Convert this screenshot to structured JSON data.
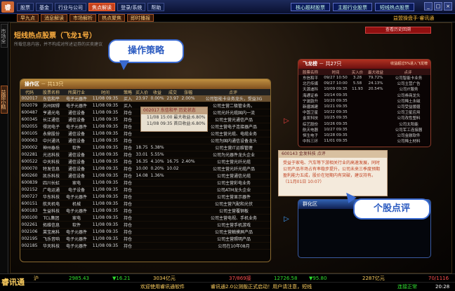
{
  "topbar": {
    "logo": "睿",
    "menu": [
      "股票",
      "基金",
      "行业与公司",
      "焦点解读",
      "登录/系统",
      "帮助"
    ],
    "active_menu": "焦点解读",
    "right_buttons": [
      "核心题材股票",
      "主题行业股票",
      "短线热点股票"
    ],
    "window_controls": [
      "_",
      "□",
      "×"
    ]
  },
  "subbar": {
    "items": [
      "早九点",
      "消息解读",
      "市场解析",
      "热点聚焦",
      "即时播报"
    ],
    "brand": "益盟操盘手·睿讯通"
  },
  "rail": {
    "market": "市场全景",
    "wizard": "益盟小精灵"
  },
  "page": {
    "title": "短线热点股票（飞龙1号）",
    "subtitle": "所载信息内容，并不构成对所述证券的买卖建议",
    "history_btn": "查看历史回溯"
  },
  "callouts": {
    "strategy": "操作策略",
    "review": "个股点评"
  },
  "op_panel": {
    "title": "操作区",
    "count": "－ 共13只",
    "columns": [
      "代码",
      "股票名称",
      "所属行业",
      "时间",
      "策略",
      "买入价",
      "收益",
      "成交",
      "涨幅",
      "点评"
    ],
    "rows": [
      {
        "code": "002017",
        "name": "东信和平",
        "ind": "电子元器件",
        "time": "11/08 09:35",
        "act": "买入",
        "price": "23.97",
        "gain": "0.00%",
        "vol": "23.97",
        "chg": "2.00%",
        "note": "公司智能卡业务龙头，受益3G",
        "sel": true
      },
      {
        "code": "002079",
        "name": "苏州固锝",
        "ind": "电子元器件",
        "time": "11/08 09:35",
        "act": "买入",
        "price": "",
        "gain": "",
        "vol": "",
        "chg": "",
        "note": "公司主营二极管业务。"
      },
      {
        "code": "600487",
        "name": "亨通光电",
        "ind": "通信设备",
        "time": "11/08 09:35",
        "act": "持仓",
        "price": "",
        "gain": "",
        "vol": "",
        "chg": "",
        "note": "公司光纤光缆国内一流"
      },
      {
        "code": "600345",
        "name": "长江通信",
        "ind": "通信设备",
        "time": "11/08 09:35",
        "act": "持仓",
        "price": "",
        "gain": "",
        "vol": "",
        "chg": "",
        "note": "公司主营光通信产品"
      },
      {
        "code": "002055",
        "name": "得润电子",
        "ind": "电子元器件",
        "time": "11/08 09:35",
        "act": "持仓",
        "price": "",
        "gain": "",
        "vol": "",
        "chg": "",
        "note": "公司主营电子连接器产品"
      },
      {
        "code": "600105",
        "name": "永鼎股份",
        "ind": "通信设备",
        "time": "11/08 09:35",
        "act": "持仓",
        "price": "",
        "gain": "",
        "vol": "",
        "chg": "",
        "note": "公司主营光缆、电缆业务"
      },
      {
        "code": "000063",
        "name": "中兴通讯",
        "ind": "通信设备",
        "time": "11/08 09:35",
        "act": "持仓",
        "price": "",
        "gain": "",
        "vol": "",
        "chg": "",
        "note": "公司为国内通信设备龙头"
      },
      {
        "code": "300002",
        "name": "神州泰岳",
        "ind": "软件",
        "time": "11/08 09:35",
        "act": "持仓",
        "price": "18.75",
        "gain": "5.38%",
        "vol": "",
        "chg": "",
        "note": "公司主营IT运维管理"
      },
      {
        "code": "002281",
        "name": "光迅科技",
        "ind": "通信设备",
        "time": "11/08 09:35",
        "act": "持仓",
        "price": "33.01",
        "gain": "5.55%",
        "vol": "",
        "chg": "",
        "note": "公司为光器件龙头企业"
      },
      {
        "code": "600522",
        "name": "中天科技",
        "ind": "通信设备",
        "time": "11/08 09:35",
        "act": "持仓",
        "price": "16.35",
        "gain": "4.10%",
        "vol": "16.75",
        "chg": "2.40%",
        "note": "公司主营光纤光缆"
      },
      {
        "code": "000070",
        "name": "特发信息",
        "ind": "通信设备",
        "time": "11/08 09:35",
        "act": "持仓",
        "price": "10.00",
        "gain": "0.20%",
        "vol": "10.02",
        "chg": "",
        "note": "公司主营光纤光缆产品"
      },
      {
        "code": "600260",
        "name": "凯乐科技",
        "ind": "通信设备",
        "time": "11/08 09:35",
        "act": "持仓",
        "price": "14.08",
        "gain": "1.36%",
        "vol": "",
        "chg": "",
        "note": "公司主营通信光缆"
      },
      {
        "code": "600839",
        "name": "四川长虹",
        "ind": "家电",
        "time": "11/08 09:35",
        "act": "持仓",
        "price": "",
        "gain": "",
        "vol": "",
        "chg": "",
        "note": "公司主营彩电业务"
      },
      {
        "code": "002152",
        "name": "广电运通",
        "ind": "电子设备",
        "time": "11/08 09:35",
        "act": "持仓",
        "price": "",
        "gain": "",
        "vol": "",
        "chg": "",
        "note": "公司ATM龙头企业"
      },
      {
        "code": "000727",
        "name": "华东科技",
        "ind": "电子元器件",
        "time": "11/08 09:35",
        "act": "持仓",
        "price": "",
        "gain": "",
        "vol": "",
        "chg": "",
        "note": "公司主营显示器件"
      },
      {
        "code": "600151",
        "name": "航天机电",
        "ind": "机械",
        "time": "11/08 09:35",
        "act": "持仓",
        "price": "",
        "gain": "",
        "vol": "",
        "chg": "",
        "note": "公司主营汽配和光伏"
      },
      {
        "code": "600183",
        "name": "生益科技",
        "ind": "电子元器件",
        "time": "11/08 09:35",
        "act": "持仓",
        "price": "",
        "gain": "",
        "vol": "",
        "chg": "",
        "note": "公司主营覆铜板"
      },
      {
        "code": "000100",
        "name": "TCL集团",
        "ind": "家电",
        "time": "11/08 09:35",
        "act": "持仓",
        "price": "",
        "gain": "",
        "vol": "",
        "chg": "",
        "note": "公司主营电视、手机业务"
      },
      {
        "code": "002261",
        "name": "拓维信息",
        "ind": "软件",
        "time": "11/08 09:35",
        "act": "持仓",
        "price": "",
        "gain": "",
        "vol": "",
        "chg": "",
        "note": "公司主营手机游戏"
      },
      {
        "code": "002106",
        "name": "莱宝高科",
        "ind": "电子元器件",
        "time": "11/08 09:35",
        "act": "持仓",
        "price": "",
        "gain": "",
        "vol": "",
        "chg": "",
        "note": "公司主营触摸屏产品"
      },
      {
        "code": "002195",
        "name": "飞乐音响",
        "ind": "电子元器件",
        "time": "11/08 09:35",
        "act": "持仓",
        "price": "",
        "gain": "",
        "vol": "",
        "chg": "",
        "note": "公司主营照明产品"
      },
      {
        "code": "002185",
        "name": "华天科技",
        "ind": "电子元器件",
        "time": "11/08 09:35",
        "act": "持仓",
        "price": "",
        "gain": "",
        "vol": "",
        "chg": "",
        "note": "公司在10年08月"
      }
    ]
  },
  "history_popup": {
    "title": "002017 东信和平  历史状态",
    "rows": [
      "11/08 15:00    最大收益:6.80%",
      "11/08 09:35    首日收益:6.80%"
    ]
  },
  "dragon_panel": {
    "title": "飞龙榜",
    "count": "－ 共27只",
    "extra": "收益超过5%进入飞龙榜",
    "columns": [
      "股票名称",
      "时间",
      "买入价",
      "最大收益",
      "点评"
    ],
    "rows": [
      {
        "name": "东信和平",
        "time": "09/27 10:50",
        "price": "3.28",
        "gain": "79.72%",
        "note": "公司智能卡业务"
      },
      {
        "name": "北巴传媒",
        "time": "09/27 10:00",
        "price": "5.58",
        "gain": "24.13%",
        "note": "公司主营广告"
      },
      {
        "name": "天源迪科",
        "time": "10/09 09:35",
        "price": "11.93",
        "gain": "20.54%",
        "note": "公司IT服务"
      },
      {
        "name": "海通证券",
        "time": "10/14 09:35",
        "price": "",
        "gain": "",
        "note": "公司券商龙头"
      },
      {
        "name": "宁波韵升",
        "time": "10/20 09:35",
        "price": "",
        "gain": "",
        "note": "公司稀土永磁"
      },
      {
        "name": "新疆城建",
        "time": "10/21 09:35",
        "price": "",
        "gain": "",
        "note": "公司受益援疆"
      },
      {
        "name": "中国卫星",
        "time": "10/22 09:35",
        "price": "",
        "gain": "",
        "note": "公司卫星应用"
      },
      {
        "name": "金发科技",
        "time": "10/25 09:35",
        "price": "",
        "gain": "",
        "note": "公司改性塑料"
      },
      {
        "name": "综艺股份",
        "time": "10/26 09:35",
        "price": "",
        "gain": "",
        "note": "公司太阳能"
      },
      {
        "name": "航天电器",
        "time": "10/27 09:35",
        "price": "",
        "gain": "",
        "note": "公司军工连接器"
      },
      {
        "name": "恒生电子",
        "time": "10/28 09:35",
        "price": "",
        "gain": "",
        "note": "公司金融软件"
      },
      {
        "name": "中科三环",
        "time": "11/01 09:35",
        "price": "",
        "gain": "",
        "note": "公司稀土材料"
      }
    ]
  },
  "comment_popup": {
    "title": "600143 金发科技   点评",
    "body": "受益于家电、汽车等下游相关行业的高速发展，同时公司产品市场占有率稳步提升，公司未来三季度预期盈利能力五成，股价在短期内有突破，建议持有。（11月01日 10:07）"
  },
  "group_panel": {
    "title": "群化区"
  },
  "footer": {
    "logo": "睿讯通",
    "sh_label": "沪",
    "sh_value": "2985.43",
    "sh_change": "▼16.21",
    "sh_amount": "3034亿元",
    "sz_ratio": "37/869接",
    "sz_value": "12726.58",
    "sz_change": "▼95.80",
    "sz_amount": "2287亿元",
    "count": "70/1116",
    "welcome": "欢迎使用睿讯通软件",
    "ticker": "睿讯通2.0公测版正式启动！用户请注意，短线",
    "status": "连接正常",
    "clock": "20:28"
  },
  "colors": {
    "accent": "#c8401a",
    "gold": "#ffb040",
    "callout_border": "#3a6ad0"
  }
}
